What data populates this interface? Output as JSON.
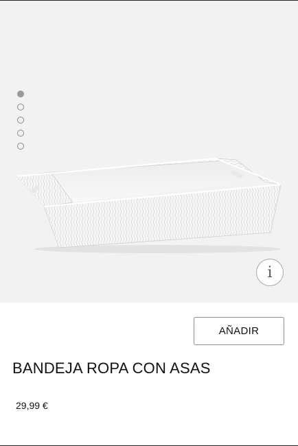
{
  "gallery": {
    "image_count": 5,
    "active_index": 0,
    "image_subject": "white woven laundry basket tray with handles"
  },
  "info_button": {
    "icon": "info-icon",
    "glyph": "i"
  },
  "actions": {
    "add_label": "AÑADIR"
  },
  "product": {
    "title": "BANDEJA ROPA CON ASAS",
    "price": "29,99 €"
  },
  "colors": {
    "gallery_background": "#f2f2f2",
    "text": "#111111",
    "button_border": "#8c8c8c"
  }
}
